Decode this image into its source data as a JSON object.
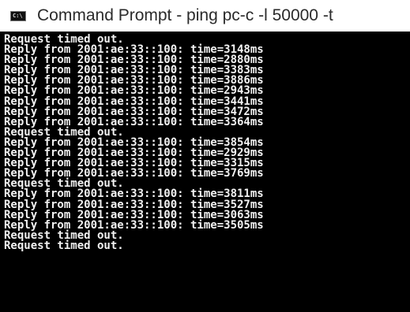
{
  "window": {
    "icon_text": "C:\\",
    "title": "Command Prompt - ping  pc-c -l 50000 -t"
  },
  "console": {
    "lines": [
      "Request timed out.",
      "Reply from 2001:ae:33::100: time=3148ms",
      "Reply from 2001:ae:33::100: time=2880ms",
      "Reply from 2001:ae:33::100: time=3383ms",
      "Reply from 2001:ae:33::100: time=3886ms",
      "Reply from 2001:ae:33::100: time=2943ms",
      "Reply from 2001:ae:33::100: time=3441ms",
      "Reply from 2001:ae:33::100: time=3472ms",
      "Reply from 2001:ae:33::100: time=3364ms",
      "Request timed out.",
      "Reply from 2001:ae:33::100: time=3854ms",
      "Reply from 2001:ae:33::100: time=2929ms",
      "Reply from 2001:ae:33::100: time=3315ms",
      "Reply from 2001:ae:33::100: time=3769ms",
      "Request timed out.",
      "Reply from 2001:ae:33::100: time=3811ms",
      "Reply from 2001:ae:33::100: time=3527ms",
      "Reply from 2001:ae:33::100: time=3063ms",
      "Reply from 2001:ae:33::100: time=3505ms",
      "Request timed out.",
      "Request timed out."
    ]
  },
  "colors": {
    "console_background": "#000000",
    "console_text": "#f2f2f2",
    "titlebar_background": "#ffffff",
    "title_text": "#2b2b2b"
  }
}
